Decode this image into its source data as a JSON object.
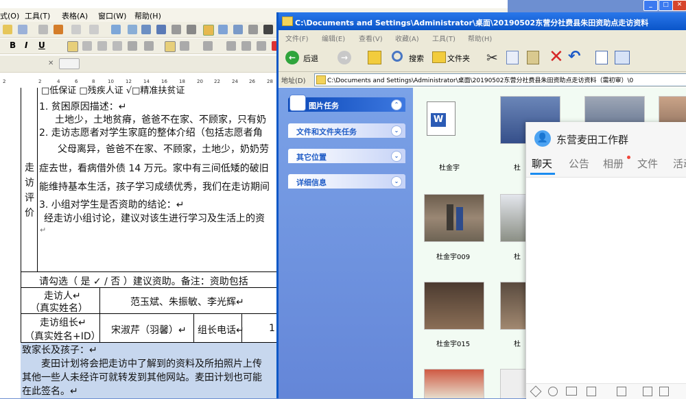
{
  "word": {
    "menu": [
      "式(O)",
      "工具(T)",
      "表格(A)",
      "窗口(W)",
      "帮助(H)"
    ],
    "ruler_ticks": [
      "2",
      "2",
      "4",
      "6",
      "8",
      "10",
      "12",
      "14",
      "16",
      "18",
      "20",
      "22",
      "24",
      "26",
      "28"
    ],
    "lines": {
      "top_partial": "□低保证    □残疾人证    √□精准扶贫证",
      "l1": "1.  贫困原因描述：↵",
      "l2": "土地少，土地贫瘠，爸爸不在家、不顾家，只有奶",
      "l3": "2.  走访志愿者对学生家庭的整体介绍（包括志愿者角",
      "l4": "父母离异，爸爸不在家、不顾家，土地少，奶奶劳",
      "l5": "症去世，看病借外债 14 万元。家中有三间低矮的破旧",
      "l6": "能维持基本生活，孩子学习成绩优秀，我们在走访期间",
      "l7": "3.  小组对学生是否资助的结论：↵",
      "l8": "经走访小组讨论，建议对该生进行学习及生活上的资",
      "l9": "↵",
      "choose": "请勾选（ 是   ✓  / 否 ）建议资助。备注：资助包括",
      "visitor_label": "走访人↵",
      "visitor_label2": "（真实姓名）",
      "visitor_names": "范玉斌、朱振敏、李光辉↵",
      "leader_label": "走访组长↵",
      "leader_label2": "（真实姓名+ID）",
      "leader_name": "宋淑芹（羽馨）↵",
      "leader_phone_label": "组长电话↵",
      "leader_phone_partial": "1",
      "p1": "致家长及孩子：↵",
      "p2": "麦田计划将会把走访中了解到的资料及所拍照片上传",
      "p3": "其他一些人未经许可就转发到其他网站。麦田计划也可能",
      "p4": "在此签名。↵",
      "side_label": [
        "走",
        "访",
        "评",
        "价"
      ]
    }
  },
  "explorer": {
    "title": "C:\\Documents and Settings\\Administrator\\桌面\\20190502东营分社费县朱田资助点走访资料",
    "menu": [
      "文件(F)",
      "编辑(E)",
      "查看(V)",
      "收藏(A)",
      "工具(T)",
      "帮助(H)"
    ],
    "toolbar": {
      "back": "后退",
      "search": "搜索",
      "folders": "文件夹"
    },
    "address_label": "地址(D)",
    "address_value": "C:\\Documents and Settings\\Administrator\\桌面\\20190502东营分社费县朱田资助点走访资料（需初审）\\0",
    "tasks": [
      "图片任务",
      "文件和文件夹任务",
      "其它位置",
      "详细信息"
    ],
    "files": [
      {
        "name": "杜金宇"
      },
      {
        "name": "杜"
      },
      {
        "name": "杜金宇009"
      },
      {
        "name": "杜"
      },
      {
        "name": "杜金宇015"
      },
      {
        "name": "杜"
      }
    ]
  },
  "qq": {
    "group_name": "东营麦田工作群",
    "tabs": [
      "聊天",
      "公告",
      "相册",
      "文件",
      "活动"
    ]
  },
  "colors": {
    "xp_blue": "#0a55c9",
    "task_blue": "#6d8fd1",
    "content_green": "#f2fbf3",
    "selection": "#c7d7ee"
  }
}
